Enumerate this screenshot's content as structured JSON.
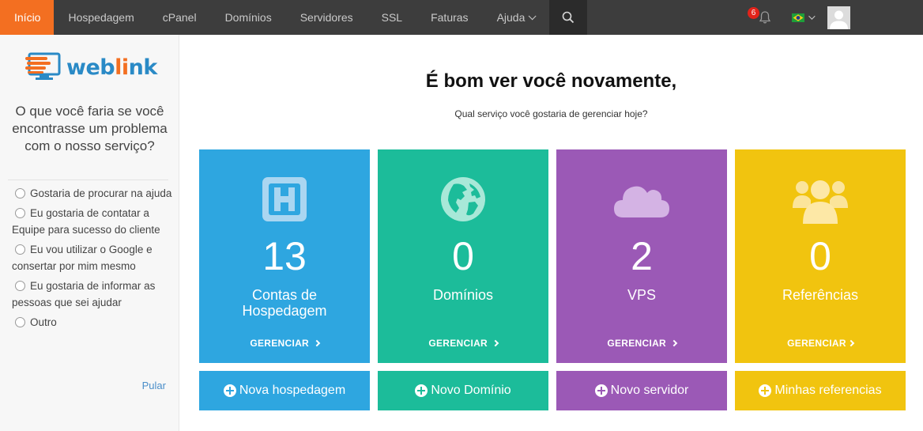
{
  "nav": {
    "items": [
      {
        "label": "Início"
      },
      {
        "label": "Hospedagem"
      },
      {
        "label": "cPanel"
      },
      {
        "label": "Domínios"
      },
      {
        "label": "Servidores"
      },
      {
        "label": "SSL"
      },
      {
        "label": "Faturas"
      },
      {
        "label": "Ajuda"
      }
    ],
    "active_color": "#f36f21",
    "notification_count": "6",
    "search_icon": "search-icon",
    "bell_icon": "bell-icon"
  },
  "sidebar": {
    "logo_text_a": "web",
    "logo_text_b": "li",
    "logo_text_c": "nk",
    "question": "O que você faria se você encontrasse um problema com o nosso serviço?",
    "options": [
      {
        "label": "Gostaria de procurar na ajuda"
      },
      {
        "label": "Eu gostaria de contatar a Equipe para sucesso do cliente"
      },
      {
        "label": "Eu vou utilizar o Google e consertar por mim mesmo"
      },
      {
        "label": "Eu gostaria de informar as pessoas que sei ajudar"
      },
      {
        "label": "Outro"
      }
    ],
    "skip": "Pular"
  },
  "main": {
    "title": "É bom ver você novamente,",
    "subtitle": "Qual serviço você gostaria de gerenciar hoje?",
    "cards": [
      {
        "count": "13",
        "label": "Contas de Hospedagem",
        "manage": "GERENCIAR",
        "color": "#2ea6e0",
        "icon": "hosting-h-icon"
      },
      {
        "count": "0",
        "label": "Domínios",
        "manage": "GERENCIAR",
        "color": "#1cbc9a",
        "icon": "globe-icon"
      },
      {
        "count": "2",
        "label": "VPS",
        "manage": "GERENCIAR",
        "color": "#9b59b6",
        "icon": "cloud-icon"
      },
      {
        "count": "0",
        "label": "Referências",
        "manage": "GERENCIAR",
        "color": "#f1c40f",
        "icon": "users-icon"
      }
    ],
    "actions": [
      {
        "label": "Nova hospedagem"
      },
      {
        "label": "Novo Domínio"
      },
      {
        "label": "Novo servidor"
      },
      {
        "label": "Minhas referencias"
      }
    ]
  }
}
